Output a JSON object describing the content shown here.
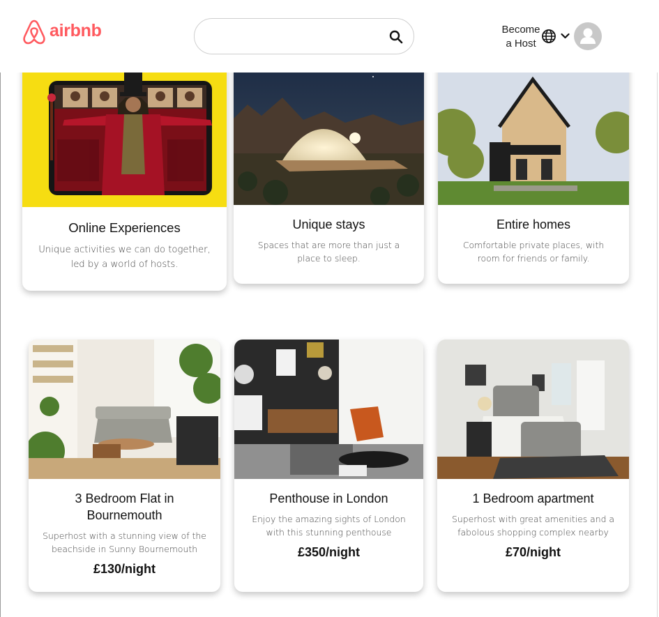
{
  "brand": {
    "name": "airbnb",
    "color": "#ff5a5f"
  },
  "search": {
    "value": "",
    "placeholder": "",
    "icon": "search-icon"
  },
  "nav": {
    "host_line1": "Become",
    "host_line2": "a Host",
    "globe_icon": "globe-icon",
    "chevron_icon": "chevron-down-icon",
    "avatar_icon": "user-avatar-icon"
  },
  "categories": [
    {
      "title": "Online Experiences",
      "description": "Unique activities we can do together, led by a world of hosts."
    },
    {
      "title": "Unique stays",
      "description": "Spaces that are more than just a place to sleep."
    },
    {
      "title": "Entire homes",
      "description": "Comfortable private places, with room for friends or family."
    }
  ],
  "listings": [
    {
      "title": "3 Bedroom Flat in Bournemouth",
      "description": "Superhost with a stunning view of the beachside in Sunny Bournemouth",
      "price": "£130/night"
    },
    {
      "title": "Penthouse in London",
      "description": "Enjoy the amazing sights of London with this stunning penthouse",
      "price": "£350/night"
    },
    {
      "title": "1 Bedroom apartment",
      "description": "Superhost with great amenities and a fabolous shopping complex nearby",
      "price": "£70/night"
    }
  ]
}
